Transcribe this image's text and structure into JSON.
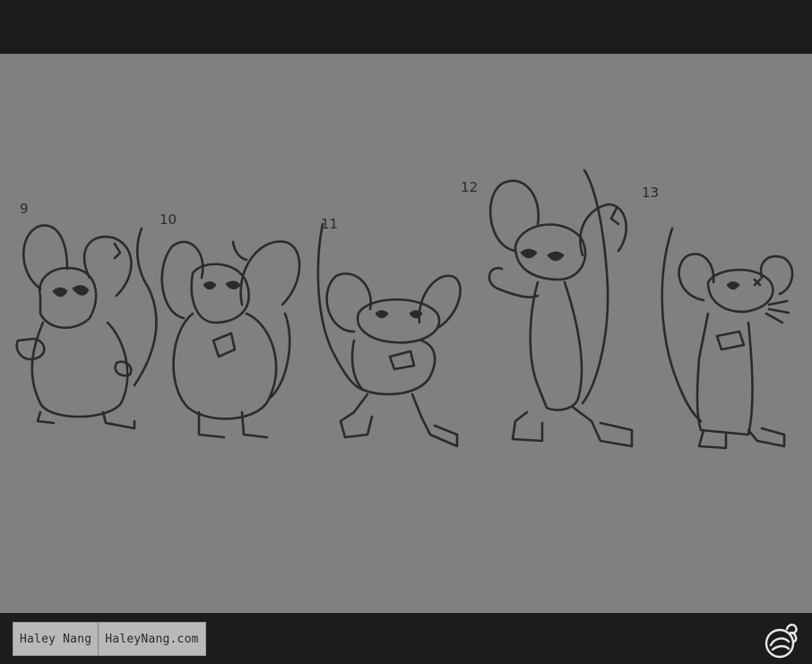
{
  "sketch_numbers": [
    "9",
    "10",
    "11",
    "12",
    "13"
  ],
  "credit": {
    "name": "Haley Nang",
    "site": "HaleyNang.com"
  },
  "logo": {
    "icon": "leaf-swirl-logo-icon"
  },
  "colors": {
    "frame": "#1d1c1c",
    "canvas": "#808080",
    "ink": "#2b2b2b"
  }
}
